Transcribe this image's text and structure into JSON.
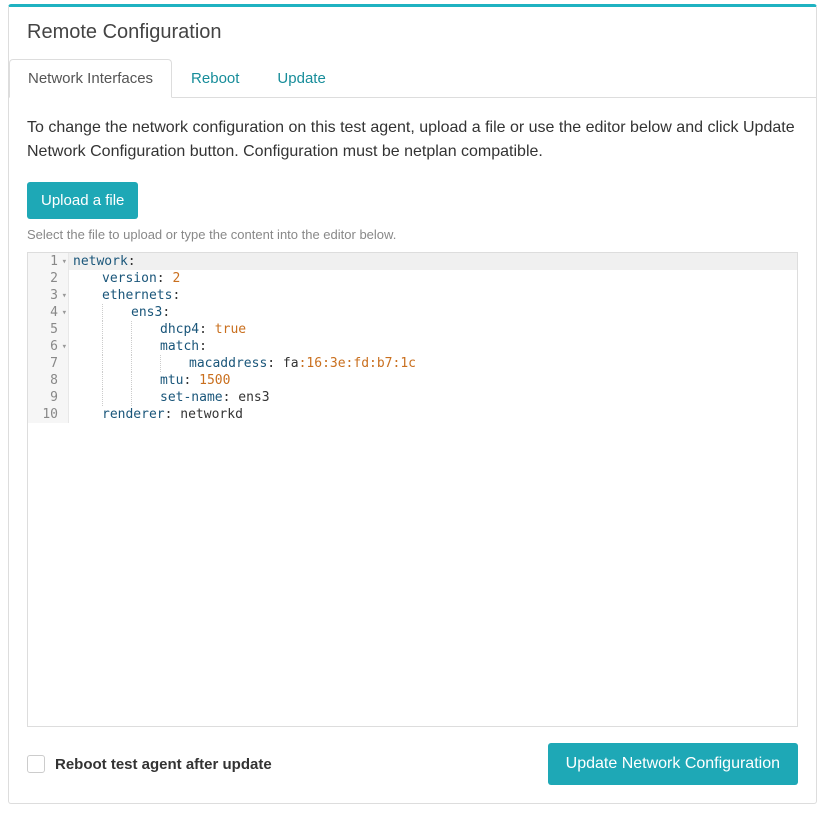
{
  "header": {
    "title": "Remote Configuration"
  },
  "tabs": [
    {
      "label": "Network Interfaces",
      "active": true
    },
    {
      "label": "Reboot",
      "active": false
    },
    {
      "label": "Update",
      "active": false
    }
  ],
  "instructions": "To change the network configuration on this test agent, upload a file or use the editor below and click Update Network Configuration button. Configuration must be netplan compatible.",
  "upload_button": "Upload a file",
  "helper_text": "Select the file to upload or type the content into the editor below.",
  "editor_lines": [
    {
      "n": 1,
      "fold": true,
      "indent": 0,
      "tokens": [
        {
          "t": "network",
          "c": "key"
        },
        {
          "t": ":",
          "c": "plain"
        }
      ]
    },
    {
      "n": 2,
      "fold": false,
      "indent": 1,
      "tokens": [
        {
          "t": "version",
          "c": "key"
        },
        {
          "t": ": ",
          "c": "plain"
        },
        {
          "t": "2",
          "c": "num"
        }
      ]
    },
    {
      "n": 3,
      "fold": true,
      "indent": 1,
      "tokens": [
        {
          "t": "ethernets",
          "c": "key"
        },
        {
          "t": ":",
          "c": "plain"
        }
      ]
    },
    {
      "n": 4,
      "fold": true,
      "indent": 2,
      "tokens": [
        {
          "t": "ens3",
          "c": "key"
        },
        {
          "t": ":",
          "c": "plain"
        }
      ]
    },
    {
      "n": 5,
      "fold": false,
      "indent": 3,
      "tokens": [
        {
          "t": "dhcp4",
          "c": "key"
        },
        {
          "t": ": ",
          "c": "plain"
        },
        {
          "t": "true",
          "c": "bool"
        }
      ]
    },
    {
      "n": 6,
      "fold": true,
      "indent": 3,
      "tokens": [
        {
          "t": "match",
          "c": "key"
        },
        {
          "t": ":",
          "c": "plain"
        }
      ]
    },
    {
      "n": 7,
      "fold": false,
      "indent": 4,
      "tokens": [
        {
          "t": "macaddress",
          "c": "key"
        },
        {
          "t": ": fa",
          "c": "plain"
        },
        {
          "t": ":16:3e:fd:b7:1c",
          "c": "num"
        }
      ]
    },
    {
      "n": 8,
      "fold": false,
      "indent": 3,
      "tokens": [
        {
          "t": "mtu",
          "c": "key"
        },
        {
          "t": ": ",
          "c": "plain"
        },
        {
          "t": "1500",
          "c": "num"
        }
      ]
    },
    {
      "n": 9,
      "fold": false,
      "indent": 3,
      "tokens": [
        {
          "t": "set-name",
          "c": "key"
        },
        {
          "t": ": ens3",
          "c": "plain"
        }
      ]
    },
    {
      "n": 10,
      "fold": false,
      "indent": 1,
      "tokens": [
        {
          "t": "renderer",
          "c": "key"
        },
        {
          "t": ": networkd",
          "c": "plain"
        }
      ]
    }
  ],
  "footer": {
    "checkbox_label": "Reboot test agent after update",
    "submit_label": "Update Network Configuration"
  }
}
